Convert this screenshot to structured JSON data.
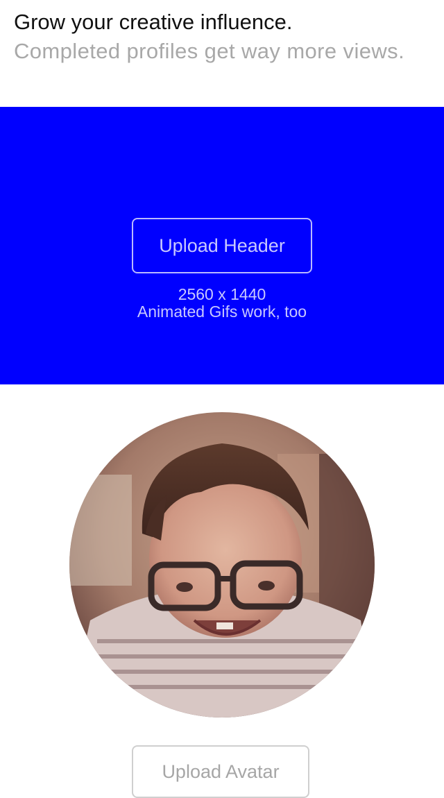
{
  "intro": {
    "title": "Grow your creative influence.",
    "subtitle": "Completed profiles get way more views."
  },
  "header_upload": {
    "button_label": "Upload Header",
    "dimensions": "2560 x 1440",
    "note": "Animated Gifs work, too",
    "background_color": "#0000ff"
  },
  "avatar_upload": {
    "button_label": "Upload Avatar"
  }
}
